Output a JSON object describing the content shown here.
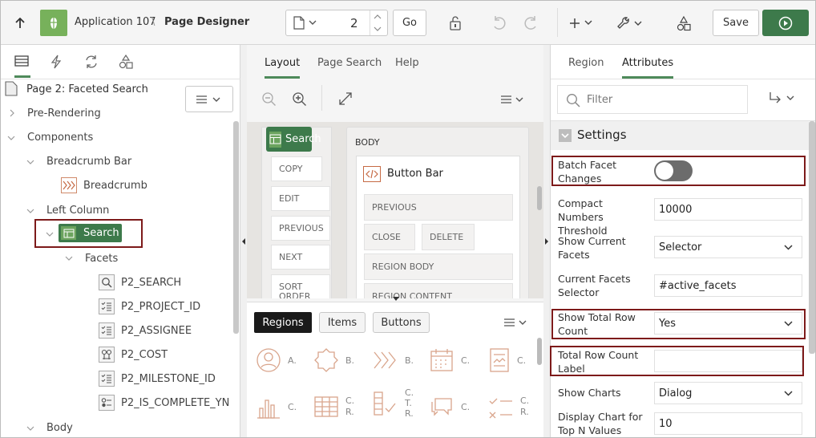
{
  "toolbar": {
    "app_name": "Application 107",
    "separator": "\\",
    "page_designer_title": "Page Designer",
    "page_number": "2",
    "go_label": "Go",
    "save_label": "Save",
    "accent": "#3d7a4b"
  },
  "left": {
    "page_title": "Page 2: Faceted Search",
    "tree": {
      "pre_rendering": "Pre-Rendering",
      "components": "Components",
      "breadcrumb_bar": "Breadcrumb Bar",
      "breadcrumb": "Breadcrumb",
      "left_column": "Left Column",
      "search": "Search",
      "facets": "Facets",
      "items": [
        "P2_SEARCH",
        "P2_PROJECT_ID",
        "P2_ASSIGNEE",
        "P2_COST",
        "P2_MILESTONE_ID",
        "P2_IS_COMPLETE_YN"
      ],
      "body": "Body"
    }
  },
  "middle": {
    "tabs": [
      "Layout",
      "Page Search",
      "Help"
    ],
    "search_region": "Search",
    "buttons": [
      "COPY",
      "EDIT",
      "PREVIOUS",
      "NEXT",
      "SORT ORDER"
    ],
    "body_label": "BODY",
    "button_bar": "Button Bar",
    "bb_slots": [
      "PREVIOUS",
      "CLOSE",
      "DELETE",
      "REGION BODY",
      "REGION CONTENT"
    ],
    "gallery_tabs": [
      "Regions",
      "Items",
      "Buttons"
    ],
    "gallery_row1": [
      "A.",
      "B.",
      "B.",
      "C.",
      "C."
    ],
    "gallery_row2": [
      "C.",
      "C.\nR.",
      "C.\nT.\nR.",
      "C.",
      "C.\nR."
    ]
  },
  "right": {
    "tabs": [
      "Region",
      "Attributes"
    ],
    "filter_placeholder": "Filter",
    "settings_title": "Settings",
    "props": {
      "batch": "Batch Facet Changes",
      "compact_label": "Compact Numbers Threshold",
      "compact_value": "10000",
      "show_current_label": "Show Current Facets",
      "show_current_value": "Selector",
      "current_selector_label": "Current Facets Selector",
      "current_selector_value": "#active_facets",
      "show_total_label": "Show Total Row Count",
      "show_total_value": "Yes",
      "total_label_label": "Total Row Count Label",
      "total_label_value": "",
      "show_charts_label": "Show Charts",
      "show_charts_value": "Dialog",
      "display_chart_label": "Display Chart for Top N Values",
      "display_chart_value": "10"
    }
  }
}
